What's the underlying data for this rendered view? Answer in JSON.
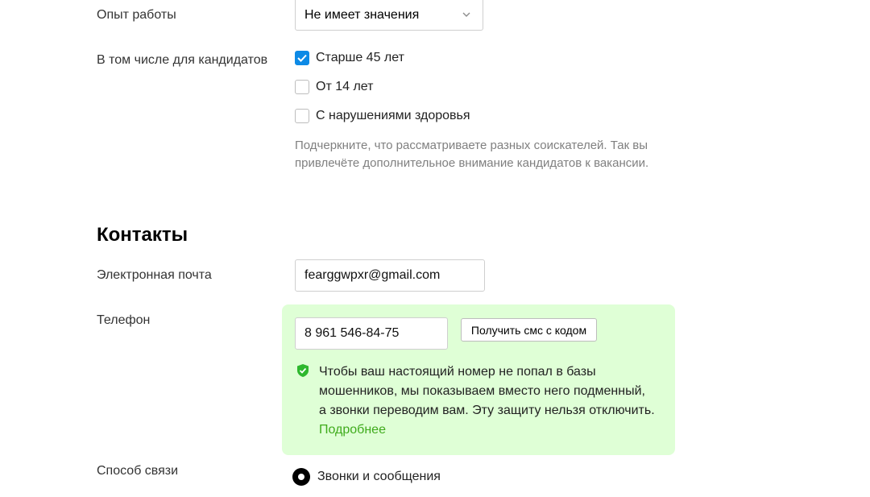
{
  "experience": {
    "label": "Опыт работы",
    "selected": "Не имеет значения"
  },
  "candidates": {
    "label": "В том числе для кандидатов",
    "options": [
      {
        "label": "Старше 45 лет",
        "checked": true
      },
      {
        "label": "От 14 лет",
        "checked": false
      },
      {
        "label": "С нарушениями здоровья",
        "checked": false
      }
    ],
    "hint_line1": "Подчеркните, что рассматриваете разных соискателей. Так вы",
    "hint_line2": "привлечёте дополнительное внимание кандидатов к вакансии."
  },
  "contacts": {
    "title": "Контакты",
    "email_label": "Электронная почта",
    "email_value": "fearggwpxr@gmail.com",
    "phone_label": "Телефон",
    "phone_value": "8 961 546-84-75",
    "sms_button": "Получить смс с кодом",
    "protection_line1": "Чтобы ваш настоящий номер не попал в базы",
    "protection_line2": "мошенников, мы показываем вместо него подменный,",
    "protection_line3": "а звонки переводим вам. Эту защиту нельзя отключить.",
    "more_link": "Подробнее",
    "method_label": "Способ связи",
    "method_option": "Звонки и сообщения"
  },
  "colors": {
    "checkbox_checked": "#0d8ae6",
    "protection_bg": "#dfffd6",
    "link_green": "#3fab1c",
    "shield_green": "#2eb82e"
  },
  "icons": [
    "chevron-down-icon",
    "checkmark-icon",
    "shield-check-icon",
    "radio-selected-icon"
  ]
}
